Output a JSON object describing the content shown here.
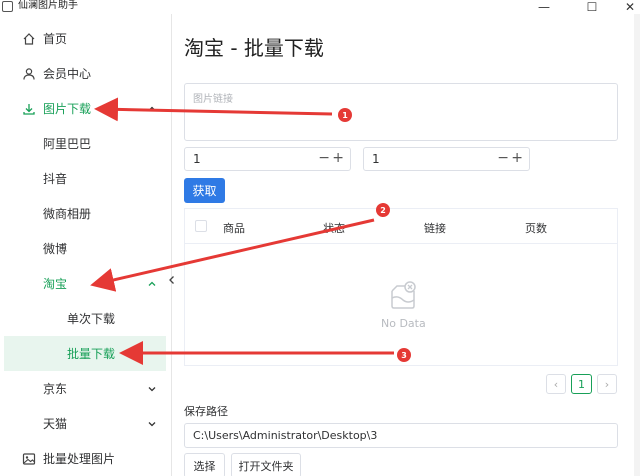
{
  "window": {
    "title": "仙澜图片助手",
    "minimize": "—",
    "maximize": "☐",
    "close": "✕"
  },
  "sidebar": {
    "home": "首页",
    "member": "会员中心",
    "image_download": "图片下载",
    "alibaba": "阿里巴巴",
    "douyin": "抖音",
    "weishang": "微商相册",
    "weibo": "微博",
    "taobao": "淘宝",
    "single_download": "单次下载",
    "batch_download": "批量下载",
    "jd": "京东",
    "tmall": "天猫",
    "batch_process": "批量处理图片"
  },
  "main": {
    "title": "淘宝 - 批量下载",
    "link_placeholder": "图片链接",
    "stepper1_value": "1",
    "stepper2_value": "1",
    "fetch_label": "获取",
    "table": {
      "headers": [
        "商品",
        "状态",
        "链接",
        "页数"
      ],
      "empty_text": "No Data"
    },
    "pagination": {
      "prev": "‹",
      "current": "1",
      "next": "›"
    },
    "save_path_label": "保存路径",
    "save_path_value": "C:\\Users\\Administrator\\Desktop\\3",
    "choose_label": "选择",
    "open_folder_label": "打开文件夹"
  },
  "annotations": {
    "badge1": "1",
    "badge2": "2",
    "badge3": "3",
    "color": "#e53935"
  },
  "colors": {
    "accent": "#18a058",
    "primary_button": "#2f7ae5"
  }
}
